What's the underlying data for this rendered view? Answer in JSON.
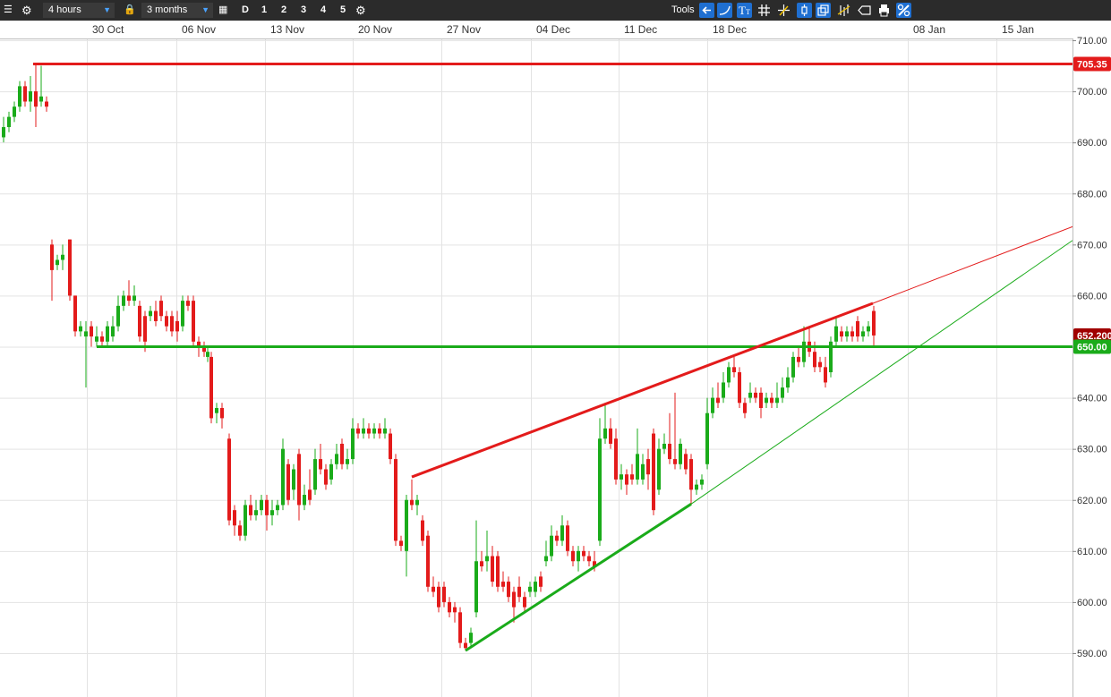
{
  "toolbar": {
    "interval": "4 hours",
    "range": "3 months",
    "day_button": "D",
    "layout_buttons": [
      "1",
      "2",
      "3",
      "4",
      "5"
    ],
    "tools_label": "Tools",
    "icons": [
      "menu-icon",
      "gear-icon",
      "lock-icon",
      "calendar-icon",
      "gear-icon",
      "back-arrow-icon",
      "curve-icon",
      "text-icon",
      "grid-icon",
      "crosshair-icon",
      "candle-icon",
      "copy-icon",
      "indicator-icon",
      "label-icon",
      "print-icon",
      "settings-icon"
    ]
  },
  "chart_data": {
    "type": "candlestick",
    "x_tick_labels": [
      "30 Oct",
      "06 Nov",
      "13 Nov",
      "20 Nov",
      "27 Nov",
      "04 Dec",
      "11 Dec",
      "18 Dec",
      "08 Jan",
      "15 Jan"
    ],
    "y_tick_labels": [
      "710.00",
      "700.00",
      "690.00",
      "680.00",
      "670.00",
      "660.00",
      "650.00",
      "640.00",
      "630.00",
      "620.00",
      "610.00",
      "600.00",
      "590.00"
    ],
    "ylim": [
      586,
      713
    ],
    "grid": true,
    "price_markers": [
      {
        "label": "705.35",
        "value": 705.35,
        "color": "#e31b1b"
      },
      {
        "label": "652.200",
        "value": 652.2,
        "color": "#a00000"
      },
      {
        "label": "650.00",
        "value": 650.0,
        "color": "#1aab1a"
      }
    ],
    "horizontal_lines": [
      {
        "name": "resistance",
        "value": 705.35,
        "color": "#e31b1b"
      },
      {
        "name": "support",
        "value": 650.0,
        "color": "#1aab1a"
      }
    ],
    "trend_lines": [
      {
        "name": "upper-trend",
        "from": [
          460,
          624.5
        ],
        "to": [
          975,
          658.5
        ],
        "color": "#e31b1b"
      },
      {
        "name": "upper-trend-extension",
        "from": [
          975,
          658.5
        ],
        "to": [
          1198,
          673.5
        ],
        "color": "#e31b1b"
      },
      {
        "name": "lower-trend",
        "from": [
          520,
          590.5
        ],
        "to": [
          772,
          619.2
        ],
        "color": "#1aab1a"
      },
      {
        "name": "lower-trend-extension",
        "from": [
          772,
          619.2
        ],
        "to": [
          1198,
          670.8
        ],
        "color": "#1aab1a"
      }
    ],
    "candles": [
      {
        "x": 4,
        "o": 691,
        "c": 693,
        "h": 695,
        "l": 690
      },
      {
        "x": 10,
        "o": 693,
        "c": 695,
        "h": 696,
        "l": 692
      },
      {
        "x": 16,
        "o": 695,
        "c": 697,
        "h": 698,
        "l": 694
      },
      {
        "x": 22,
        "o": 697,
        "c": 701,
        "h": 702,
        "l": 696
      },
      {
        "x": 28,
        "o": 701,
        "c": 698,
        "h": 702,
        "l": 697
      },
      {
        "x": 34,
        "o": 698,
        "c": 700,
        "h": 703,
        "l": 696
      },
      {
        "x": 40,
        "o": 700,
        "c": 697,
        "h": 705.4,
        "l": 693
      },
      {
        "x": 46,
        "o": 698,
        "c": 699,
        "h": 705,
        "l": 697
      },
      {
        "x": 52,
        "o": 698,
        "c": 697,
        "h": 699,
        "l": 696
      },
      {
        "x": 58,
        "o": 670,
        "c": 665,
        "h": 671,
        "l": 659
      },
      {
        "x": 64,
        "o": 666,
        "c": 667,
        "h": 668,
        "l": 665
      },
      {
        "x": 70,
        "o": 667,
        "c": 668,
        "h": 670,
        "l": 665
      },
      {
        "x": 78,
        "o": 671,
        "c": 660,
        "h": 671,
        "l": 659
      },
      {
        "x": 84,
        "o": 660,
        "c": 653,
        "h": 660,
        "l": 652
      },
      {
        "x": 90,
        "o": 653,
        "c": 654,
        "h": 655,
        "l": 652
      },
      {
        "x": 96,
        "o": 652,
        "c": 653,
        "h": 655,
        "l": 642
      },
      {
        "x": 102,
        "o": 654,
        "c": 652,
        "h": 655,
        "l": 650
      },
      {
        "x": 108,
        "o": 651,
        "c": 652,
        "h": 654,
        "l": 650
      },
      {
        "x": 114,
        "o": 652,
        "c": 651,
        "h": 653,
        "l": 650
      },
      {
        "x": 120,
        "o": 651,
        "c": 654,
        "h": 655,
        "l": 650
      },
      {
        "x": 126,
        "o": 652,
        "c": 654,
        "h": 656,
        "l": 651
      },
      {
        "x": 132,
        "o": 654,
        "c": 658,
        "h": 660,
        "l": 653
      },
      {
        "x": 138,
        "o": 658,
        "c": 660,
        "h": 661,
        "l": 657
      },
      {
        "x": 144,
        "o": 660,
        "c": 659,
        "h": 663,
        "l": 658
      },
      {
        "x": 150,
        "o": 659,
        "c": 660,
        "h": 662,
        "l": 658
      },
      {
        "x": 156,
        "o": 658,
        "c": 652,
        "h": 659,
        "l": 651
      },
      {
        "x": 162,
        "o": 656,
        "c": 651,
        "h": 657,
        "l": 649
      },
      {
        "x": 168,
        "o": 656,
        "c": 657,
        "h": 658,
        "l": 655
      },
      {
        "x": 174,
        "o": 657,
        "c": 655,
        "h": 659,
        "l": 654
      },
      {
        "x": 180,
        "o": 659,
        "c": 656,
        "h": 660,
        "l": 655
      },
      {
        "x": 186,
        "o": 656,
        "c": 654,
        "h": 657,
        "l": 653
      },
      {
        "x": 192,
        "o": 656,
        "c": 653,
        "h": 657,
        "l": 652
      },
      {
        "x": 198,
        "o": 655,
        "c": 653,
        "h": 657,
        "l": 651
      },
      {
        "x": 204,
        "o": 654,
        "c": 659,
        "h": 660,
        "l": 653
      },
      {
        "x": 210,
        "o": 659,
        "c": 658,
        "h": 660,
        "l": 657
      },
      {
        "x": 216,
        "o": 659,
        "c": 651,
        "h": 660,
        "l": 650
      },
      {
        "x": 222,
        "o": 651,
        "c": 650,
        "h": 652,
        "l": 648
      },
      {
        "x": 228,
        "o": 650,
        "c": 649,
        "h": 651,
        "l": 648
      },
      {
        "x": 232,
        "o": 648,
        "c": 649,
        "h": 650,
        "l": 647
      },
      {
        "x": 236,
        "o": 648,
        "c": 636,
        "h": 649,
        "l": 635
      },
      {
        "x": 242,
        "o": 637,
        "c": 638,
        "h": 639,
        "l": 635
      },
      {
        "x": 248,
        "o": 638,
        "c": 636,
        "h": 639,
        "l": 634
      },
      {
        "x": 256,
        "o": 632,
        "c": 616,
        "h": 633,
        "l": 615
      },
      {
        "x": 262,
        "o": 618,
        "c": 615,
        "h": 619,
        "l": 613
      },
      {
        "x": 268,
        "o": 615,
        "c": 613,
        "h": 616,
        "l": 612
      },
      {
        "x": 274,
        "o": 613,
        "c": 619,
        "h": 620,
        "l": 612
      },
      {
        "x": 280,
        "o": 619,
        "c": 617,
        "h": 621,
        "l": 616
      },
      {
        "x": 286,
        "o": 617,
        "c": 618,
        "h": 620,
        "l": 616
      },
      {
        "x": 292,
        "o": 618,
        "c": 620,
        "h": 621,
        "l": 617
      },
      {
        "x": 298,
        "o": 620,
        "c": 617,
        "h": 621,
        "l": 614
      },
      {
        "x": 304,
        "o": 617,
        "c": 618,
        "h": 620,
        "l": 615
      },
      {
        "x": 310,
        "o": 618,
        "c": 619,
        "h": 620,
        "l": 617
      },
      {
        "x": 316,
        "o": 619,
        "c": 630,
        "h": 632,
        "l": 618
      },
      {
        "x": 322,
        "o": 627,
        "c": 620,
        "h": 628,
        "l": 619
      },
      {
        "x": 328,
        "o": 622,
        "c": 626,
        "h": 627,
        "l": 620
      },
      {
        "x": 334,
        "o": 629,
        "c": 619,
        "h": 630,
        "l": 616
      },
      {
        "x": 340,
        "o": 619,
        "c": 621,
        "h": 623,
        "l": 618
      },
      {
        "x": 346,
        "o": 622,
        "c": 620,
        "h": 626,
        "l": 619
      },
      {
        "x": 352,
        "o": 622,
        "c": 628,
        "h": 630,
        "l": 621
      },
      {
        "x": 358,
        "o": 628,
        "c": 626,
        "h": 631,
        "l": 625
      },
      {
        "x": 364,
        "o": 626,
        "c": 623,
        "h": 627,
        "l": 622
      },
      {
        "x": 370,
        "o": 624,
        "c": 627,
        "h": 628,
        "l": 623
      },
      {
        "x": 376,
        "o": 627,
        "c": 629,
        "h": 631,
        "l": 626
      },
      {
        "x": 382,
        "o": 631,
        "c": 627,
        "h": 632,
        "l": 626
      },
      {
        "x": 388,
        "o": 627,
        "c": 628,
        "h": 630,
        "l": 626
      },
      {
        "x": 394,
        "o": 628,
        "c": 634,
        "h": 636,
        "l": 627
      },
      {
        "x": 400,
        "o": 634,
        "c": 633,
        "h": 635,
        "l": 632
      },
      {
        "x": 406,
        "o": 633,
        "c": 634,
        "h": 636,
        "l": 632
      },
      {
        "x": 412,
        "o": 634,
        "c": 633,
        "h": 635,
        "l": 632
      },
      {
        "x": 418,
        "o": 633,
        "c": 634,
        "h": 635,
        "l": 632
      },
      {
        "x": 424,
        "o": 634,
        "c": 633,
        "h": 635,
        "l": 632
      },
      {
        "x": 430,
        "o": 633,
        "c": 634,
        "h": 636,
        "l": 632
      },
      {
        "x": 436,
        "o": 633,
        "c": 628,
        "h": 634,
        "l": 627
      },
      {
        "x": 442,
        "o": 628,
        "c": 612,
        "h": 629,
        "l": 611
      },
      {
        "x": 448,
        "o": 612,
        "c": 611,
        "h": 613,
        "l": 610
      },
      {
        "x": 454,
        "o": 610,
        "c": 620,
        "h": 621,
        "l": 605
      },
      {
        "x": 460,
        "o": 620,
        "c": 619,
        "h": 624,
        "l": 618
      },
      {
        "x": 466,
        "o": 619,
        "c": 620,
        "h": 621,
        "l": 617
      },
      {
        "x": 472,
        "o": 616,
        "c": 612,
        "h": 617,
        "l": 611
      },
      {
        "x": 478,
        "o": 613,
        "c": 603,
        "h": 614,
        "l": 602
      },
      {
        "x": 484,
        "o": 603,
        "c": 602,
        "h": 605,
        "l": 601
      },
      {
        "x": 490,
        "o": 603,
        "c": 599,
        "h": 604,
        "l": 598
      },
      {
        "x": 496,
        "o": 603,
        "c": 600,
        "h": 604,
        "l": 599
      },
      {
        "x": 502,
        "o": 600,
        "c": 598,
        "h": 601,
        "l": 597
      },
      {
        "x": 508,
        "o": 599,
        "c": 598,
        "h": 600,
        "l": 596
      },
      {
        "x": 514,
        "o": 598,
        "c": 592,
        "h": 599,
        "l": 591
      },
      {
        "x": 520,
        "o": 592,
        "c": 591,
        "h": 593,
        "l": 590.5
      },
      {
        "x": 526,
        "o": 592,
        "c": 594,
        "h": 595,
        "l": 591
      },
      {
        "x": 532,
        "o": 598,
        "c": 608,
        "h": 616,
        "l": 597
      },
      {
        "x": 538,
        "o": 608,
        "c": 607,
        "h": 610,
        "l": 606
      },
      {
        "x": 544,
        "o": 608,
        "c": 609,
        "h": 614,
        "l": 606
      },
      {
        "x": 550,
        "o": 609,
        "c": 604,
        "h": 611,
        "l": 603
      },
      {
        "x": 556,
        "o": 609,
        "c": 603,
        "h": 610,
        "l": 602
      },
      {
        "x": 562,
        "o": 604,
        "c": 603,
        "h": 606,
        "l": 602
      },
      {
        "x": 568,
        "o": 604,
        "c": 601,
        "h": 605,
        "l": 600
      },
      {
        "x": 574,
        "o": 602,
        "c": 599,
        "h": 603,
        "l": 596
      },
      {
        "x": 580,
        "o": 603,
        "c": 601,
        "h": 605,
        "l": 600
      },
      {
        "x": 586,
        "o": 601,
        "c": 599,
        "h": 602,
        "l": 598
      },
      {
        "x": 592,
        "o": 602,
        "c": 603,
        "h": 604,
        "l": 601
      },
      {
        "x": 598,
        "o": 602,
        "c": 604,
        "h": 605,
        "l": 601
      },
      {
        "x": 604,
        "o": 605,
        "c": 603,
        "h": 606,
        "l": 602
      },
      {
        "x": 610,
        "o": 608,
        "c": 609,
        "h": 612,
        "l": 607
      },
      {
        "x": 616,
        "o": 609,
        "c": 613,
        "h": 615,
        "l": 608
      },
      {
        "x": 622,
        "o": 613,
        "c": 612,
        "h": 614,
        "l": 611
      },
      {
        "x": 628,
        "o": 612,
        "c": 615,
        "h": 617,
        "l": 611
      },
      {
        "x": 634,
        "o": 615,
        "c": 610,
        "h": 616,
        "l": 609
      },
      {
        "x": 640,
        "o": 610,
        "c": 608,
        "h": 611,
        "l": 607
      },
      {
        "x": 646,
        "o": 608,
        "c": 610,
        "h": 611,
        "l": 606
      },
      {
        "x": 652,
        "o": 610,
        "c": 609,
        "h": 611,
        "l": 608
      },
      {
        "x": 658,
        "o": 609,
        "c": 608,
        "h": 610,
        "l": 607
      },
      {
        "x": 664,
        "o": 608,
        "c": 607,
        "h": 610,
        "l": 606
      },
      {
        "x": 670,
        "o": 612,
        "c": 632,
        "h": 636,
        "l": 611
      },
      {
        "x": 676,
        "o": 632,
        "c": 634,
        "h": 639,
        "l": 631
      },
      {
        "x": 682,
        "o": 634,
        "c": 631,
        "h": 636,
        "l": 630
      },
      {
        "x": 688,
        "o": 632,
        "c": 624,
        "h": 634,
        "l": 623
      },
      {
        "x": 694,
        "o": 624,
        "c": 625,
        "h": 627,
        "l": 622
      },
      {
        "x": 700,
        "o": 625,
        "c": 623,
        "h": 626,
        "l": 621
      },
      {
        "x": 706,
        "o": 625,
        "c": 624,
        "h": 627,
        "l": 623
      },
      {
        "x": 712,
        "o": 624,
        "c": 629,
        "h": 634,
        "l": 623
      },
      {
        "x": 718,
        "o": 624,
        "c": 627,
        "h": 629,
        "l": 623
      },
      {
        "x": 724,
        "o": 628,
        "c": 625,
        "h": 630,
        "l": 622
      },
      {
        "x": 730,
        "o": 633,
        "c": 618,
        "h": 634,
        "l": 617
      },
      {
        "x": 736,
        "o": 622,
        "c": 630,
        "h": 632,
        "l": 621
      },
      {
        "x": 742,
        "o": 630,
        "c": 631,
        "h": 633,
        "l": 629
      },
      {
        "x": 748,
        "o": 631,
        "c": 628,
        "h": 637,
        "l": 627
      },
      {
        "x": 754,
        "o": 628,
        "c": 627,
        "h": 641,
        "l": 626
      },
      {
        "x": 760,
        "o": 627,
        "c": 631,
        "h": 632,
        "l": 626
      },
      {
        "x": 766,
        "o": 629,
        "c": 626,
        "h": 630,
        "l": 625
      },
      {
        "x": 772,
        "o": 628,
        "c": 622,
        "h": 629,
        "l": 619
      },
      {
        "x": 778,
        "o": 622,
        "c": 623,
        "h": 624,
        "l": 621
      },
      {
        "x": 784,
        "o": 623,
        "c": 624,
        "h": 625,
        "l": 622
      },
      {
        "x": 790,
        "o": 627,
        "c": 637,
        "h": 640,
        "l": 626
      },
      {
        "x": 796,
        "o": 637,
        "c": 640,
        "h": 642,
        "l": 636
      },
      {
        "x": 802,
        "o": 640,
        "c": 639,
        "h": 643,
        "l": 638
      },
      {
        "x": 808,
        "o": 640,
        "c": 643,
        "h": 645,
        "l": 639
      },
      {
        "x": 814,
        "o": 643,
        "c": 646,
        "h": 647,
        "l": 642
      },
      {
        "x": 820,
        "o": 646,
        "c": 645,
        "h": 648,
        "l": 644
      },
      {
        "x": 826,
        "o": 645,
        "c": 639,
        "h": 646,
        "l": 638
      },
      {
        "x": 832,
        "o": 639,
        "c": 637,
        "h": 640,
        "l": 636
      },
      {
        "x": 838,
        "o": 640,
        "c": 641,
        "h": 643,
        "l": 639
      },
      {
        "x": 844,
        "o": 641,
        "c": 640,
        "h": 642,
        "l": 639
      },
      {
        "x": 850,
        "o": 641,
        "c": 638,
        "h": 642,
        "l": 636
      },
      {
        "x": 856,
        "o": 639,
        "c": 640,
        "h": 641,
        "l": 638
      },
      {
        "x": 862,
        "o": 640,
        "c": 639,
        "h": 641,
        "l": 638
      },
      {
        "x": 868,
        "o": 639,
        "c": 640,
        "h": 643,
        "l": 638
      },
      {
        "x": 874,
        "o": 640,
        "c": 642,
        "h": 644,
        "l": 639
      },
      {
        "x": 880,
        "o": 642,
        "c": 644,
        "h": 646,
        "l": 641
      },
      {
        "x": 886,
        "o": 644,
        "c": 648,
        "h": 649,
        "l": 643
      },
      {
        "x": 892,
        "o": 648,
        "c": 647,
        "h": 650,
        "l": 646
      },
      {
        "x": 898,
        "o": 647,
        "c": 651,
        "h": 654,
        "l": 646
      },
      {
        "x": 904,
        "o": 651,
        "c": 649,
        "h": 654,
        "l": 648
      },
      {
        "x": 910,
        "o": 649,
        "c": 646,
        "h": 651,
        "l": 645
      },
      {
        "x": 916,
        "o": 647,
        "c": 646,
        "h": 648,
        "l": 645
      },
      {
        "x": 922,
        "o": 646,
        "c": 643,
        "h": 648,
        "l": 642
      },
      {
        "x": 928,
        "o": 645,
        "c": 651,
        "h": 652,
        "l": 644
      },
      {
        "x": 934,
        "o": 651,
        "c": 654,
        "h": 656,
        "l": 650
      },
      {
        "x": 940,
        "o": 653,
        "c": 652,
        "h": 654,
        "l": 651
      },
      {
        "x": 946,
        "o": 652,
        "c": 653,
        "h": 654,
        "l": 651
      },
      {
        "x": 952,
        "o": 653,
        "c": 652,
        "h": 654,
        "l": 651
      },
      {
        "x": 958,
        "o": 655,
        "c": 652,
        "h": 656,
        "l": 651
      },
      {
        "x": 964,
        "o": 652,
        "c": 653,
        "h": 654,
        "l": 651
      },
      {
        "x": 970,
        "o": 653,
        "c": 654,
        "h": 655,
        "l": 652
      },
      {
        "x": 976,
        "o": 657,
        "c": 652.2,
        "h": 658,
        "l": 650
      }
    ]
  }
}
